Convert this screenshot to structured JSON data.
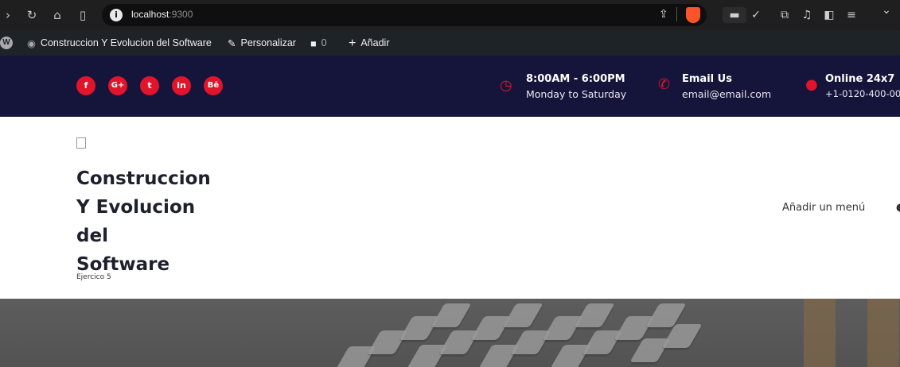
{
  "browser": {
    "url_host": "localhost",
    "url_port": ":9300"
  },
  "adminbar": {
    "site_name": "Construccion Y Evolucion del Software",
    "customize": "Personalizar",
    "comments_count": "0",
    "add_new": "Añadir"
  },
  "topbar": {
    "social": [
      "f",
      "G+",
      "t",
      "in",
      "Bē"
    ],
    "hours_title": "8:00AM - 6:00PM",
    "hours_sub": "Monday to Saturday",
    "email_title": "Email Us",
    "email_sub": "email@email.com",
    "online_title": "Online 24x7",
    "online_sub": "+1-0120-400-00"
  },
  "header": {
    "logo_alt": "Construccion Y Evolucion del Software",
    "tagline": "Ejercico 5",
    "menu_link": "Añadir un menú"
  },
  "colors": {
    "accent": "#e0142a",
    "topbar_bg": "#15153b"
  }
}
